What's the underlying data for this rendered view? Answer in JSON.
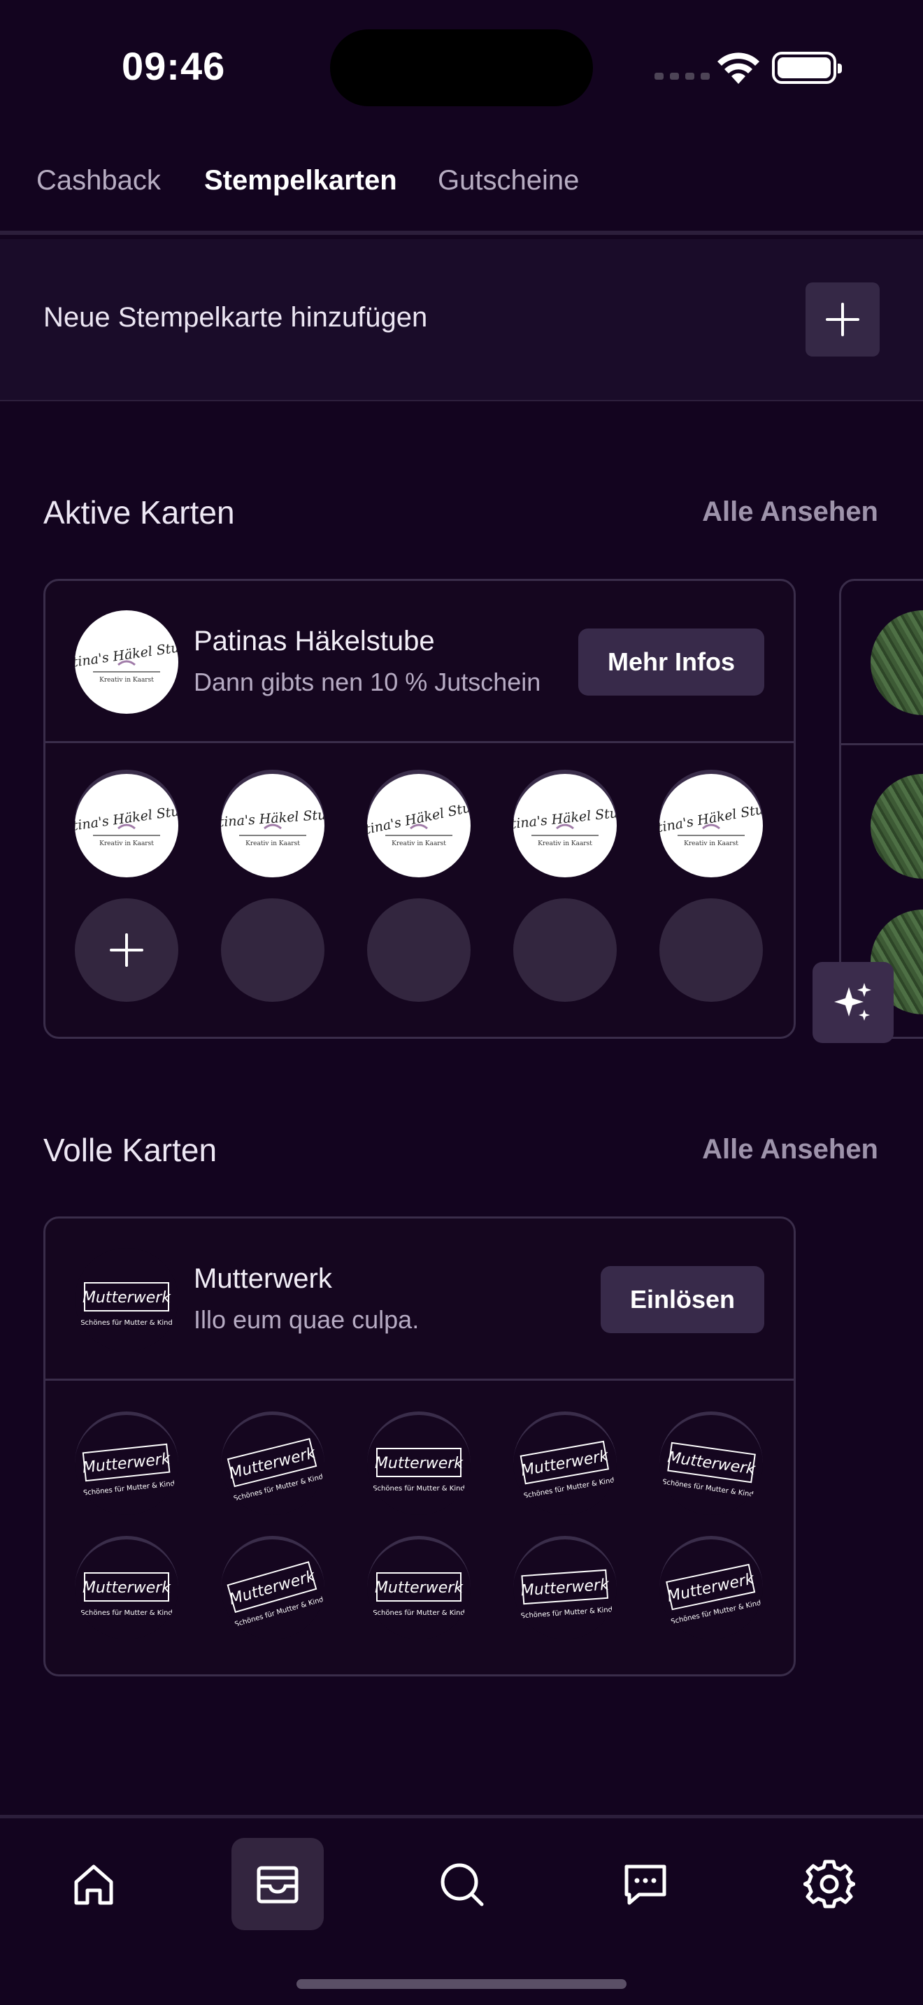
{
  "status_bar": {
    "time": "09:46"
  },
  "tabs": [
    {
      "label": "Cashback",
      "active": false
    },
    {
      "label": "Stempelkarten",
      "active": true
    },
    {
      "label": "Gutscheine",
      "active": false
    }
  ],
  "add_card": {
    "label": "Neue Stempelkarte hinzufügen",
    "icon": "plus-icon"
  },
  "active_section": {
    "title": "Aktive Karten",
    "link": "Alle Ansehen",
    "card": {
      "logo_text_main": "Patina's Häkel Stube",
      "logo_text_sub": "Kreativ in Kaarst",
      "name": "Patinas Häkelstube",
      "subtitle": "Dann gibts nen 10 % Jutschein",
      "button": "Mehr Infos",
      "stamps_collected": 5,
      "stamps_total": 10
    }
  },
  "full_section": {
    "title": "Volle Karten",
    "link": "Alle Ansehen",
    "card": {
      "logo_text_main": "Mutterwerk",
      "logo_text_sub": "Schönes für Mutter & Kind",
      "name": "Mutterwerk",
      "subtitle": "Illo eum quae culpa.",
      "button": "Einlösen",
      "stamps_collected": 10,
      "stamps_total": 10
    }
  },
  "bottom_nav": [
    {
      "icon": "home-icon",
      "active": false
    },
    {
      "icon": "wallet-icon",
      "active": true
    },
    {
      "icon": "search-icon",
      "active": false
    },
    {
      "icon": "chat-icon",
      "active": false
    },
    {
      "icon": "settings-icon",
      "active": false
    }
  ],
  "colors": {
    "background": "#13041f",
    "surface": "#1a0c29",
    "button": "#382a4a",
    "border": "#3a2d4a",
    "muted_text": "#9e93ab"
  }
}
